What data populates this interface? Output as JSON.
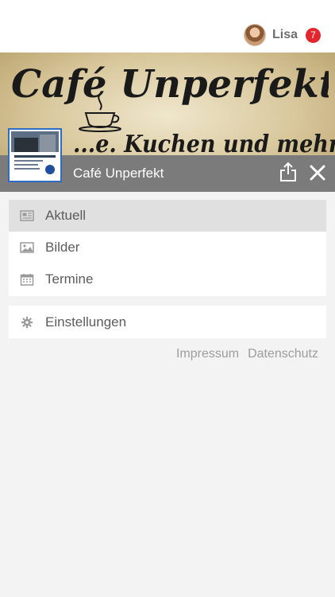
{
  "header": {
    "user_name": "Lisa",
    "notification_count": "7"
  },
  "hero": {
    "title": "Café Unperfekt",
    "subtitle": "...e. Kuchen und mehr..."
  },
  "page": {
    "name": "Café Unperfekt"
  },
  "menu": {
    "items": [
      {
        "label": "Aktuell",
        "icon": "newspaper-icon",
        "active": true
      },
      {
        "label": "Bilder",
        "icon": "image-icon",
        "active": false
      },
      {
        "label": "Termine",
        "icon": "calendar-icon",
        "active": false
      }
    ],
    "settings_label": "Einstellungen"
  },
  "footer": {
    "impressum": "Impressum",
    "datenschutz": "Datenschutz"
  },
  "colors": {
    "badge": "#e3262e",
    "title_bar": "#7b7b7b",
    "active_item": "#e0e0e0",
    "background": "#f3f3f3"
  }
}
